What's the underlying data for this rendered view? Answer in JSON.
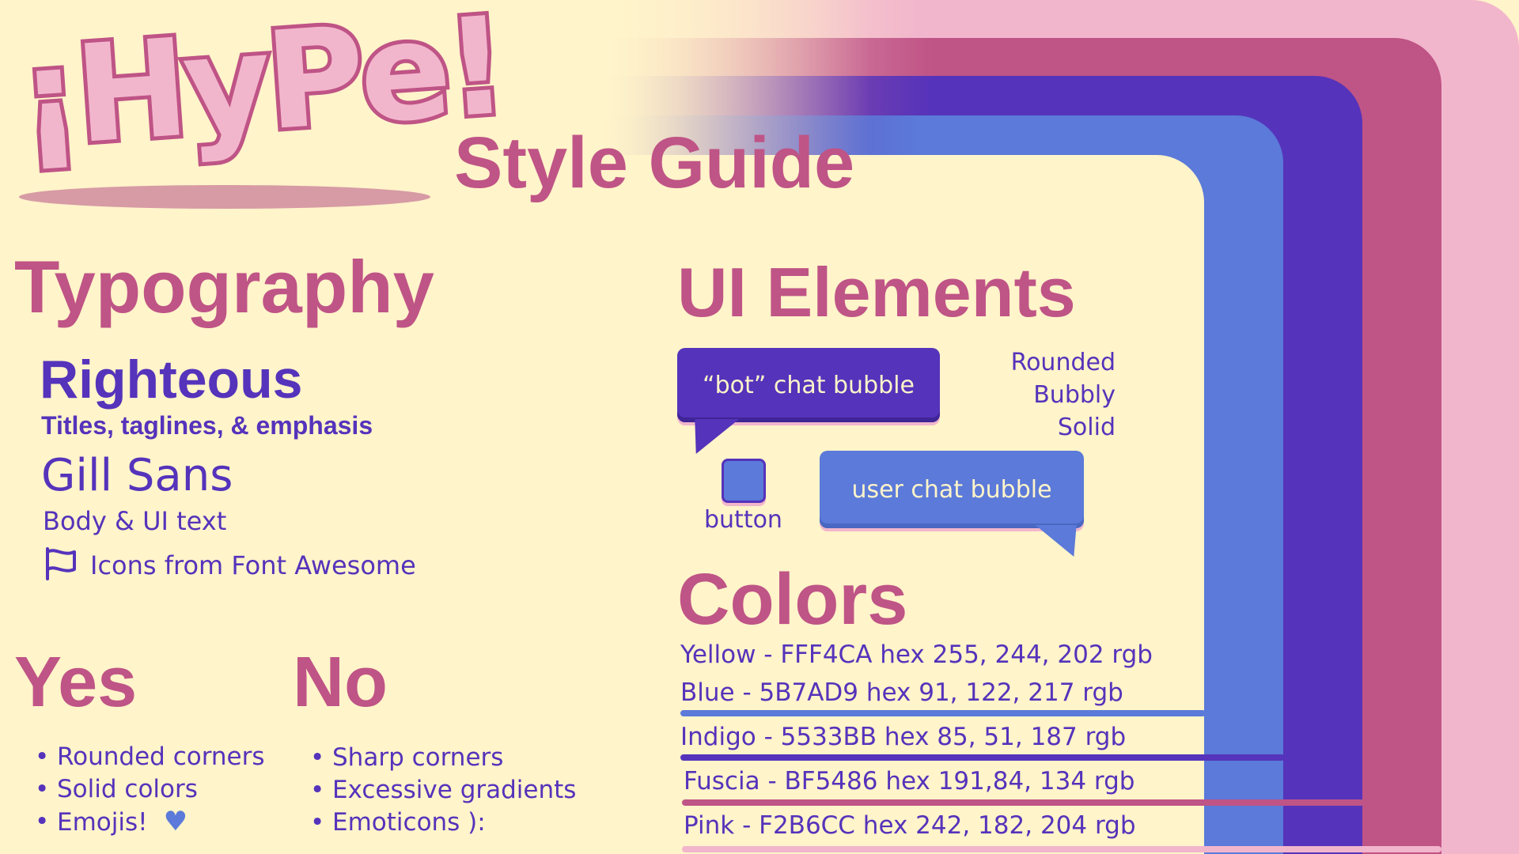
{
  "logo": {
    "text": "¡HyPe!"
  },
  "subtitle": "Style Guide",
  "typography": {
    "title": "Typography",
    "primary_font": {
      "name": "Righteous",
      "usage": "Titles, taglines, & emphasis"
    },
    "secondary_font": {
      "name": "Gill Sans",
      "usage": "Body & UI text"
    },
    "icons": {
      "icon": "flag-icon",
      "label": "Icons from Font Awesome"
    }
  },
  "ui_elements": {
    "title": "UI Elements",
    "bot_bubble": "“bot” chat bubble",
    "user_bubble": "user chat bubble",
    "button_label": "button",
    "style_words": [
      "Rounded",
      "Bubbly",
      "Solid"
    ]
  },
  "colors": {
    "title": "Colors",
    "items": [
      {
        "label": "Yellow - FFF4CA hex 255, 244, 202 rgb",
        "hex": "#FFF4CA"
      },
      {
        "label": "Blue - 5B7AD9 hex 91, 122, 217 rgb",
        "hex": "#5B7AD9"
      },
      {
        "label": "Indigo - 5533BB hex 85, 51, 187 rgb",
        "hex": "#5533BB"
      },
      {
        "label": "Fuscia - BF5486 hex 191,84, 134 rgb",
        "hex": "#BF5486"
      },
      {
        "label": "Pink - F2B6CC hex 242, 182, 204 rgb",
        "hex": "#F2B6CC"
      }
    ]
  },
  "yes": {
    "title": "Yes",
    "items": [
      "Rounded corners",
      "Solid colors",
      "Emojis!"
    ],
    "emoji": "heart-icon"
  },
  "no": {
    "title": "No",
    "items": [
      "Sharp corners",
      "Excessive gradients",
      "Emoticons ):"
    ]
  }
}
